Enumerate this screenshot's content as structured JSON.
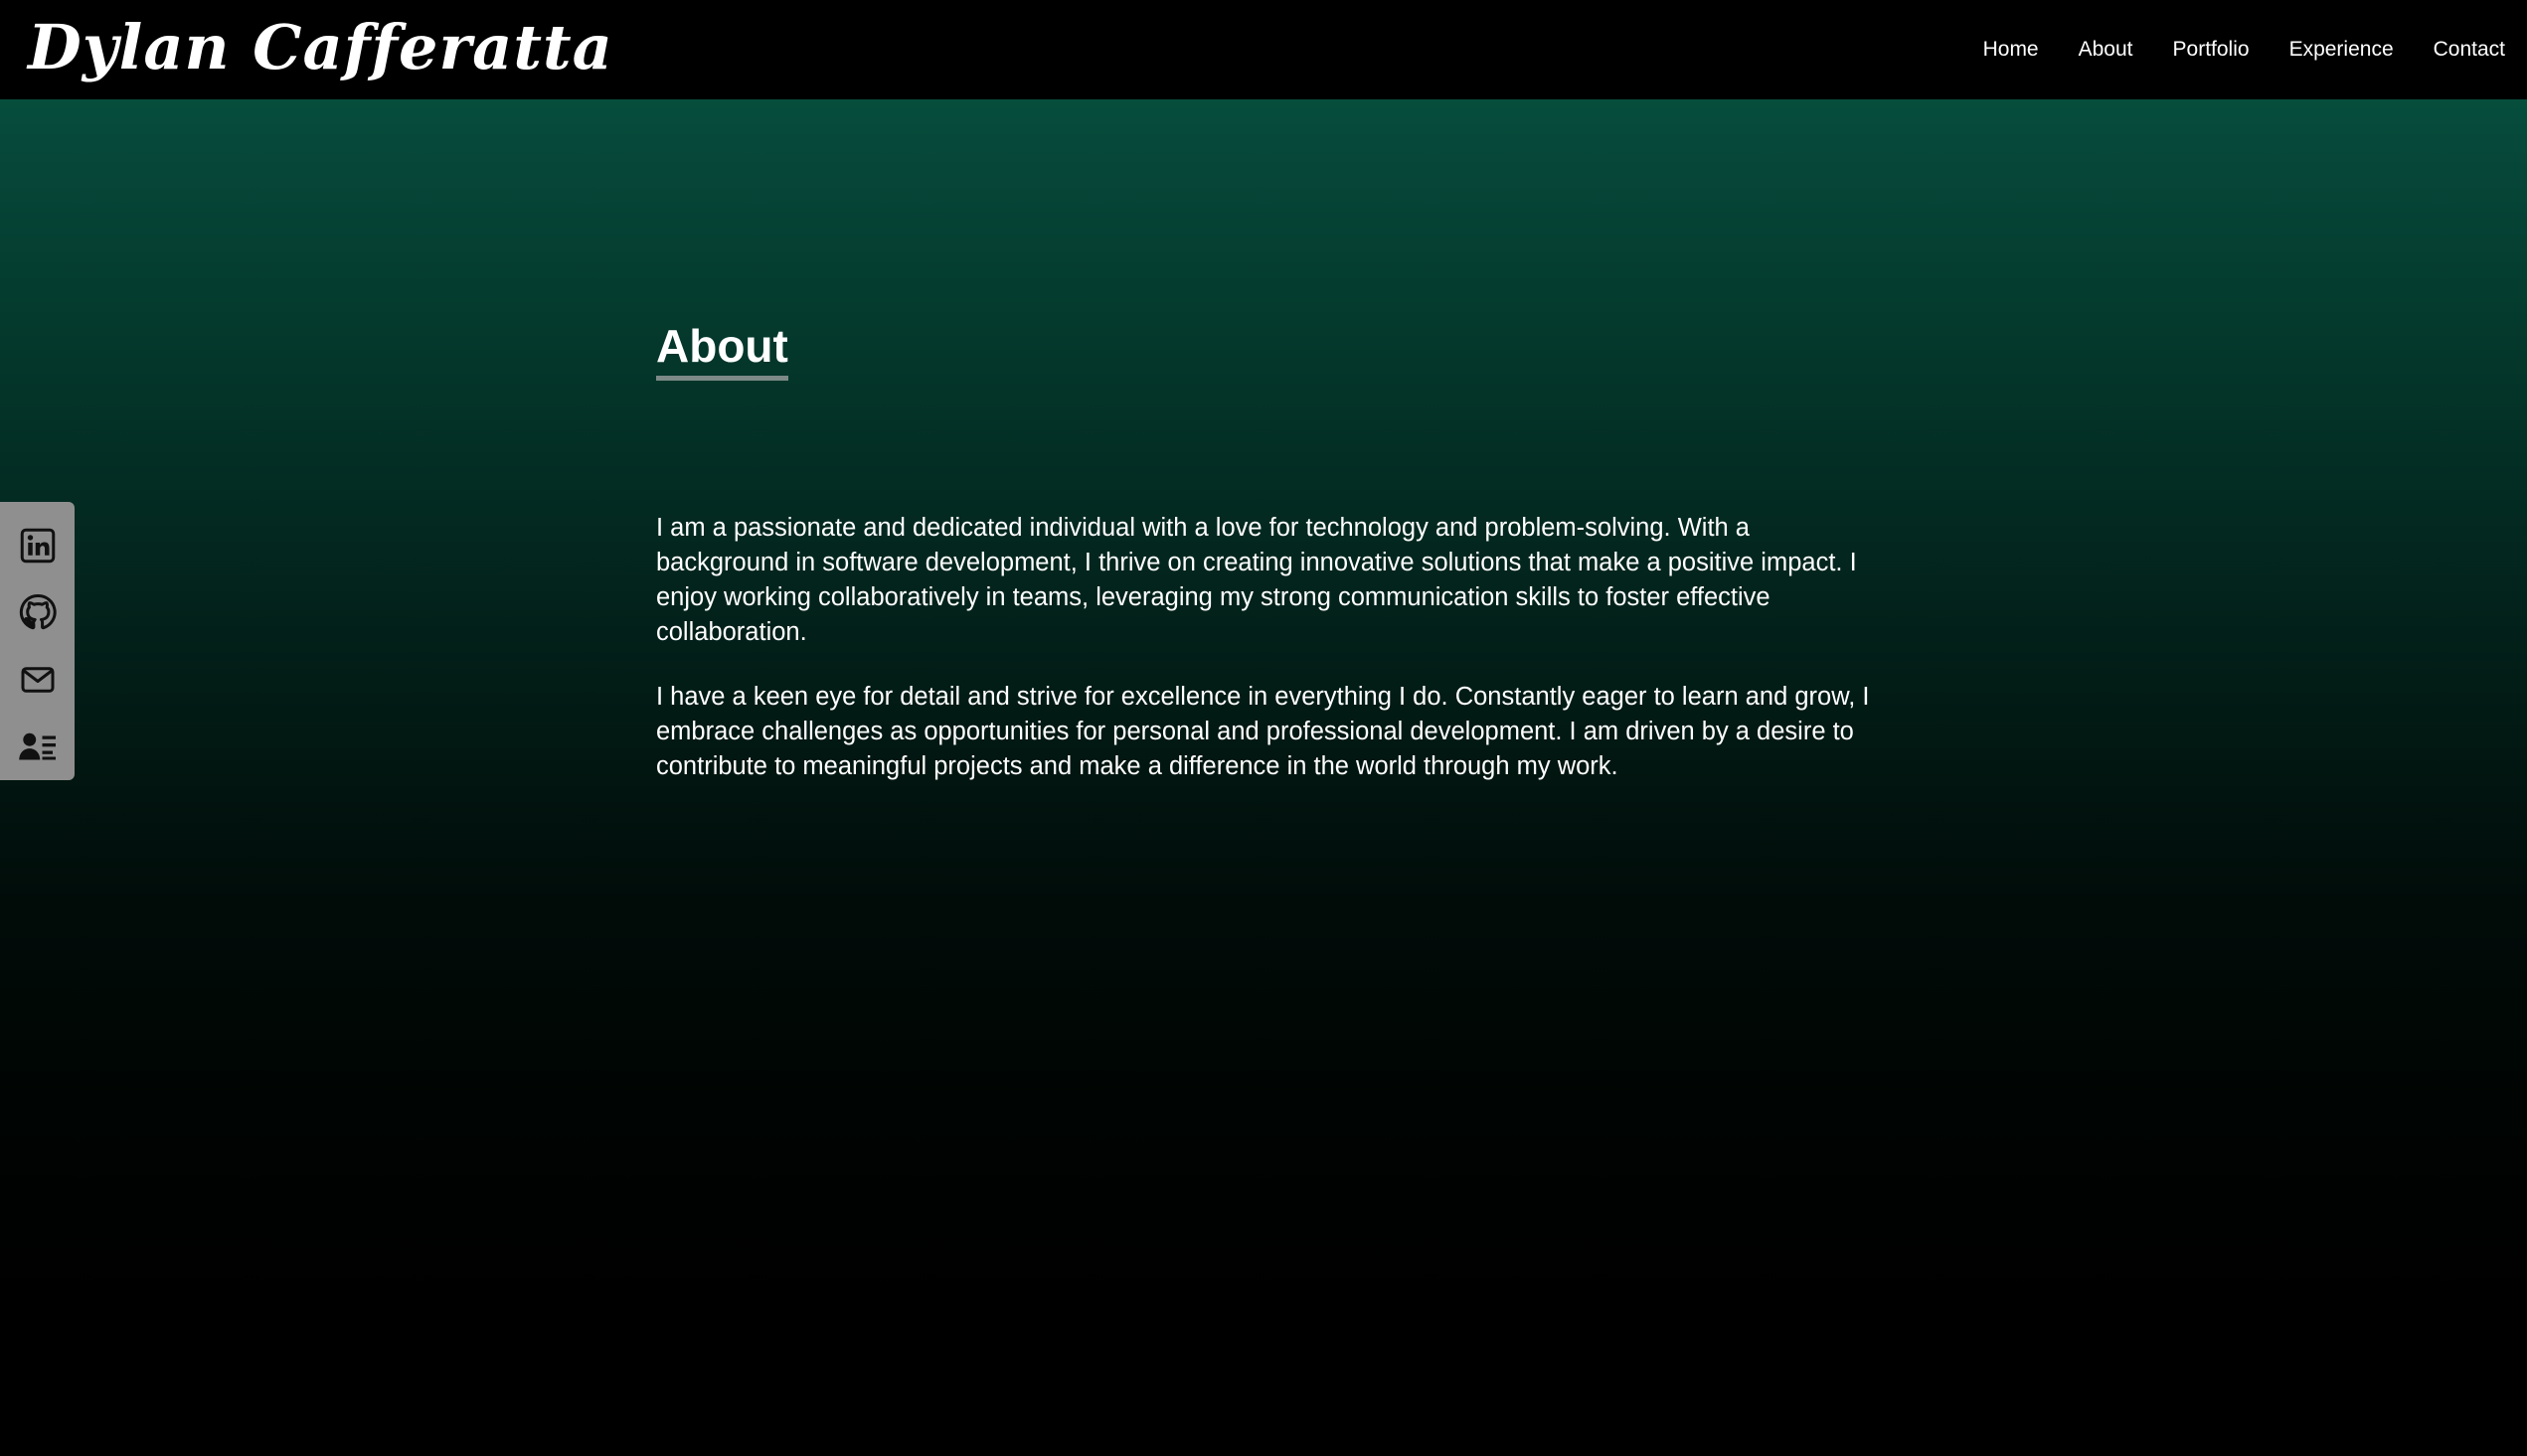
{
  "header": {
    "brand": "Dylan Cafferatta",
    "nav": [
      {
        "label": "Home"
      },
      {
        "label": "About"
      },
      {
        "label": "Portfolio"
      },
      {
        "label": "Experience"
      },
      {
        "label": "Contact"
      }
    ]
  },
  "main": {
    "title": "About",
    "paragraphs": [
      "I am a passionate and dedicated individual with a love for technology and problem-solving. With a background in software development, I thrive on creating innovative solutions that make a positive impact. I enjoy working collaboratively in teams, leveraging my strong communication skills to foster effective collaboration.",
      "I have a keen eye for detail and strive for excellence in everything I do. Constantly eager to learn and grow, I embrace challenges as opportunities for personal and professional development. I am driven by a desire to contribute to meaningful projects and make a difference in the world through my work."
    ]
  },
  "social": {
    "items": [
      {
        "icon": "linkedin-icon"
      },
      {
        "icon": "github-icon"
      },
      {
        "icon": "mail-icon"
      },
      {
        "icon": "resume-icon"
      }
    ]
  },
  "colors": {
    "background_top": "#065a42",
    "background_bottom": "#000000",
    "header_bg": "#000000",
    "social_bar_bg": "#8f8f8f",
    "heading_underline": "#7c8a87",
    "text": "#ffffff"
  }
}
